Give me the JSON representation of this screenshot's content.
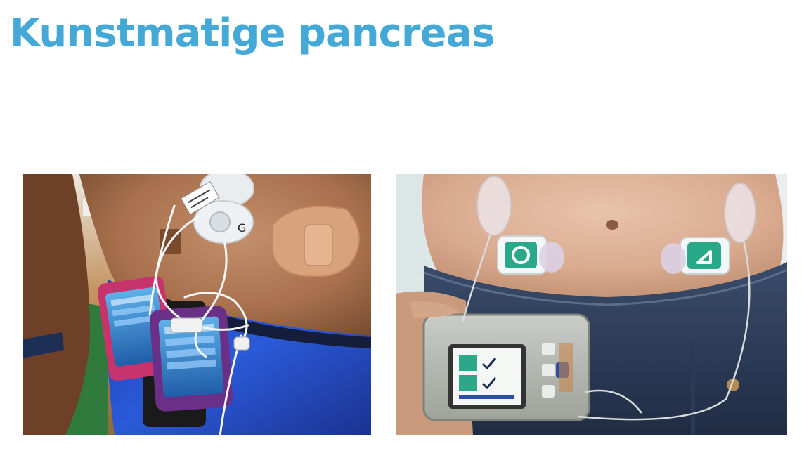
{
  "slide": {
    "title": "Kunstmatige pancreas"
  },
  "colors": {
    "title": "#45a9d8",
    "background": "#ffffff"
  },
  "images": {
    "left": {
      "type": "photo",
      "subject": "abdomen-with-sensors-and-two-handheld-devices"
    },
    "right": {
      "type": "photo",
      "subject": "abdomen-with-two-patch-sensors-and-handheld-controller"
    }
  }
}
